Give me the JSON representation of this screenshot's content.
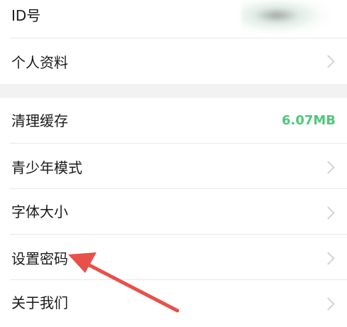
{
  "settings": {
    "items": [
      {
        "label": "ID号"
      },
      {
        "label": "个人资料"
      },
      {
        "label": "清理缓存",
        "value": "6.07MB"
      },
      {
        "label": "青少年模式"
      },
      {
        "label": "字体大小"
      },
      {
        "label": "设置密码"
      },
      {
        "label": "关于我们"
      }
    ]
  },
  "annotation": {
    "arrow_color": "#e8504a",
    "points_to": "设置密码"
  },
  "colors": {
    "value_green": "#4fc87a",
    "chevron": "#d4d4d4",
    "section_gap": "#f2f2f2"
  }
}
